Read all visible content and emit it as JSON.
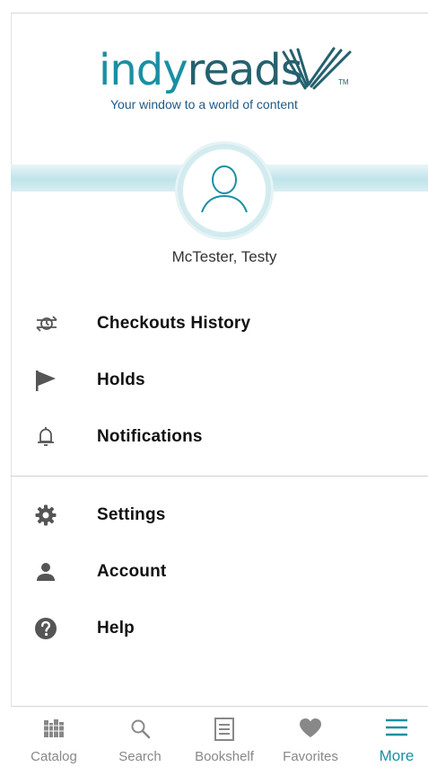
{
  "brand": {
    "logo_part1": "indy",
    "logo_part2": "reads",
    "trademark": "TM",
    "tagline": "Your window to a world of content"
  },
  "profile": {
    "name": "McTester, Testy"
  },
  "menu": {
    "checkouts_history": "Checkouts History",
    "holds": "Holds",
    "notifications": "Notifications",
    "settings": "Settings",
    "account": "Account",
    "help": "Help"
  },
  "tabs": {
    "catalog": "Catalog",
    "search": "Search",
    "bookshelf": "Bookshelf",
    "favorites": "Favorites",
    "more": "More",
    "active": "More"
  },
  "colors": {
    "accent": "#1a8fa3",
    "logo_dark": "#25616e",
    "icon_gray": "#555555",
    "tab_inactive": "#888888"
  }
}
